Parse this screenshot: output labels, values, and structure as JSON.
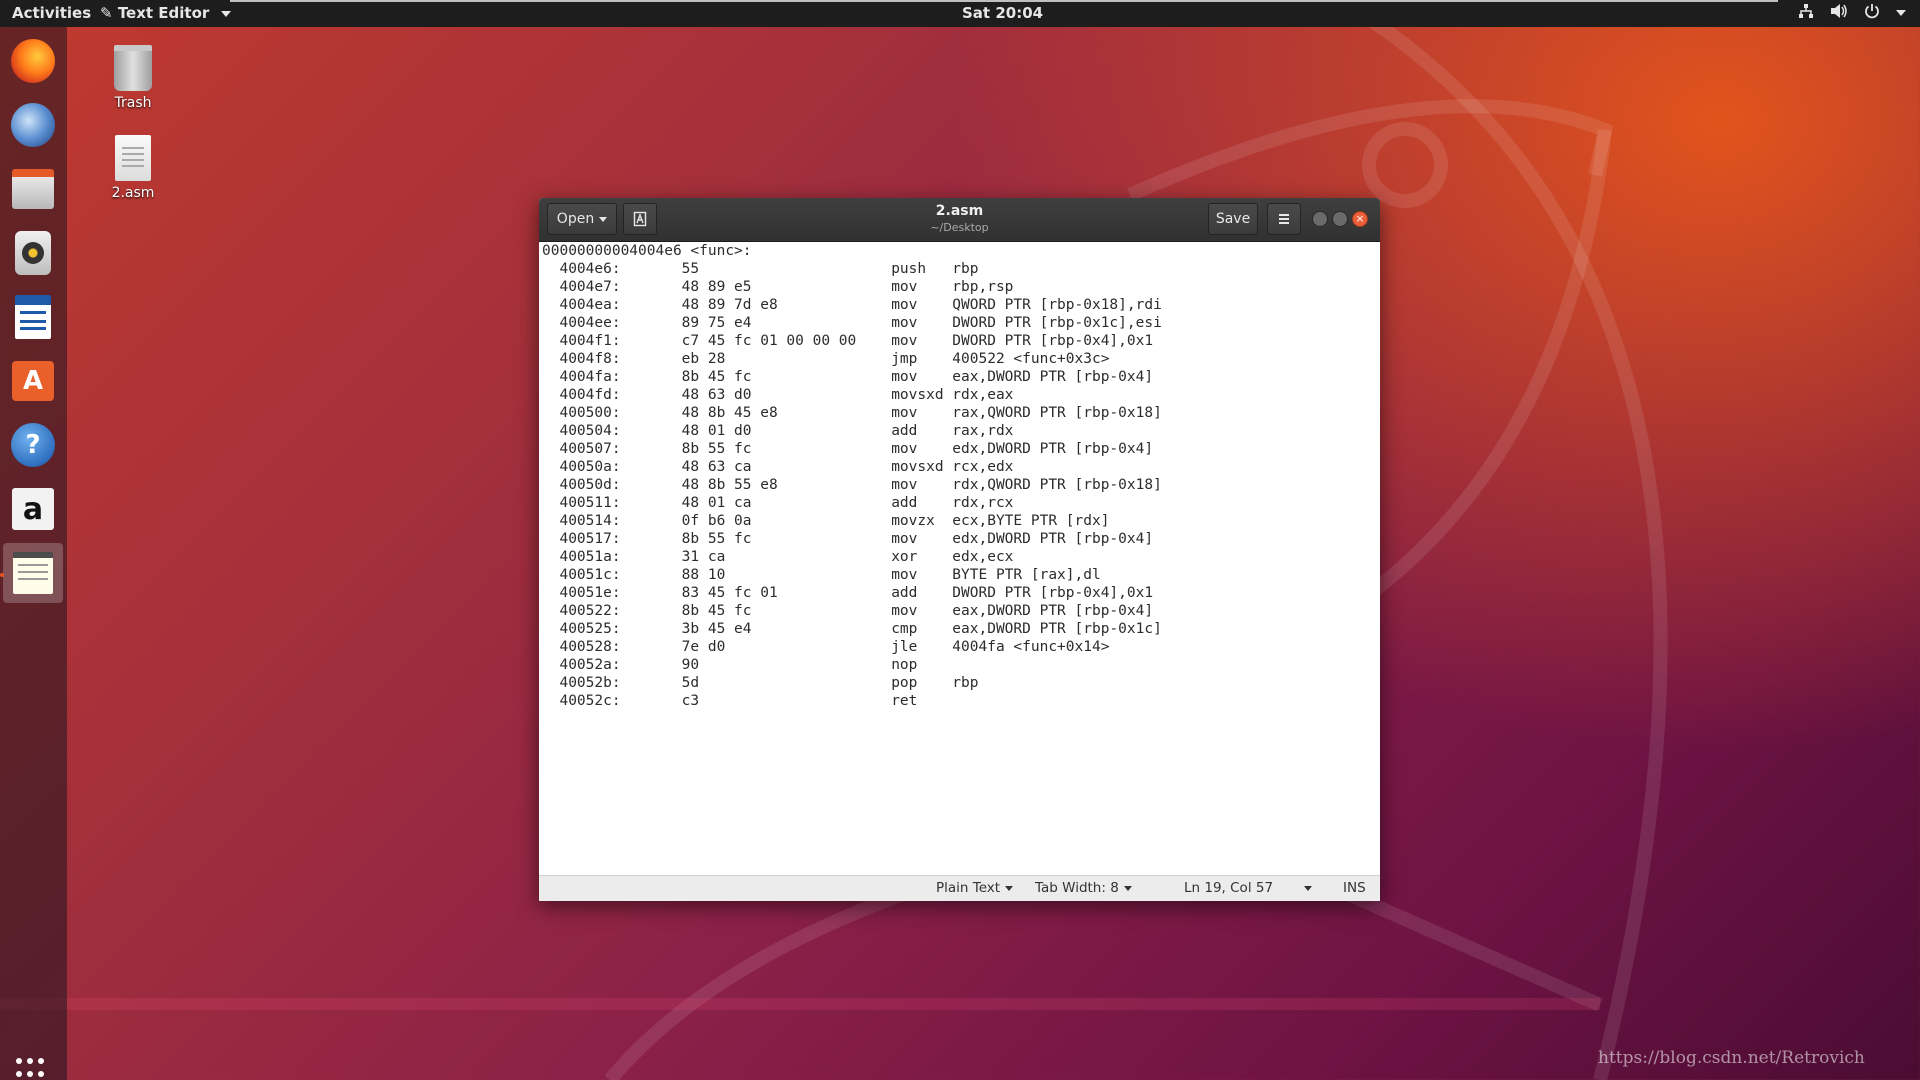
{
  "topbar": {
    "activities": "Activities",
    "app_menu": "Text Editor",
    "clock": "Sat 20:04",
    "tray_icons": [
      "network-icon",
      "volume-icon",
      "power-icon"
    ]
  },
  "dock": {
    "items": [
      {
        "name": "firefox",
        "icon": "firefox-icon"
      },
      {
        "name": "thunderbird",
        "icon": "thunderbird-icon"
      },
      {
        "name": "files",
        "icon": "files-icon"
      },
      {
        "name": "rhythmbox",
        "icon": "rhythmbox-icon"
      },
      {
        "name": "libreoffice-writer",
        "icon": "writer-icon"
      },
      {
        "name": "ubuntu-software",
        "icon": "software-icon"
      },
      {
        "name": "help",
        "icon": "help-icon"
      },
      {
        "name": "amazon",
        "icon": "amazon-icon"
      },
      {
        "name": "text-editor",
        "icon": "text-editor-icon",
        "active": true
      }
    ]
  },
  "desktop": {
    "trash_label": "Trash",
    "file_label": "2.asm"
  },
  "window": {
    "open_label": "Open",
    "save_label": "Save",
    "title": "2.asm",
    "subtitle": "~/Desktop"
  },
  "code_lines": [
    "00000000004004e6 <func>:",
    "  4004e6:\t55                   \tpush   rbp",
    "  4004e7:\t48 89 e5             \tmov    rbp,rsp",
    "  4004ea:\t48 89 7d e8          \tmov    QWORD PTR [rbp-0x18],rdi",
    "  4004ee:\t89 75 e4             \tmov    DWORD PTR [rbp-0x1c],esi",
    "  4004f1:\tc7 45 fc 01 00 00 00 \tmov    DWORD PTR [rbp-0x4],0x1",
    "  4004f8:\teb 28                \tjmp    400522 <func+0x3c>",
    "  4004fa:\t8b 45 fc             \tmov    eax,DWORD PTR [rbp-0x4]",
    "  4004fd:\t48 63 d0             \tmovsxd rdx,eax",
    "  400500:\t48 8b 45 e8          \tmov    rax,QWORD PTR [rbp-0x18]",
    "  400504:\t48 01 d0             \tadd    rax,rdx",
    "  400507:\t8b 55 fc             \tmov    edx,DWORD PTR [rbp-0x4]",
    "  40050a:\t48 63 ca             \tmovsxd rcx,edx",
    "  40050d:\t48 8b 55 e8          \tmov    rdx,QWORD PTR [rbp-0x18]",
    "  400511:\t48 01 ca             \tadd    rdx,rcx",
    "  400514:\t0f b6 0a             \tmovzx  ecx,BYTE PTR [rdx]",
    "  400517:\t8b 55 fc             \tmov    edx,DWORD PTR [rbp-0x4]",
    "  40051a:\t31 ca                \txor    edx,ecx",
    "  40051c:\t88 10                \tmov    BYTE PTR [rax],dl",
    "  40051e:\t83 45 fc 01          \tadd    DWORD PTR [rbp-0x4],0x1",
    "  400522:\t8b 45 fc             \tmov    eax,DWORD PTR [rbp-0x4]",
    "  400525:\t3b 45 e4             \tcmp    eax,DWORD PTR [rbp-0x1c]",
    "  400528:\t7e d0                \tjle    4004fa <func+0x14>",
    "  40052a:\t90                   \tnop",
    "  40052b:\t5d                   \tpop    rbp",
    "  40052c:\tc3                   \tret"
  ],
  "statusbar": {
    "language": "Plain Text",
    "tab_width": "Tab Width: 8",
    "position": "Ln 19, Col 57",
    "mode": "INS"
  },
  "watermark": "https://blog.csdn.net/Retrovich",
  "colors": {
    "accent": "#e95420",
    "topbar": "#1d1d1d",
    "headerbar": "#353535"
  }
}
